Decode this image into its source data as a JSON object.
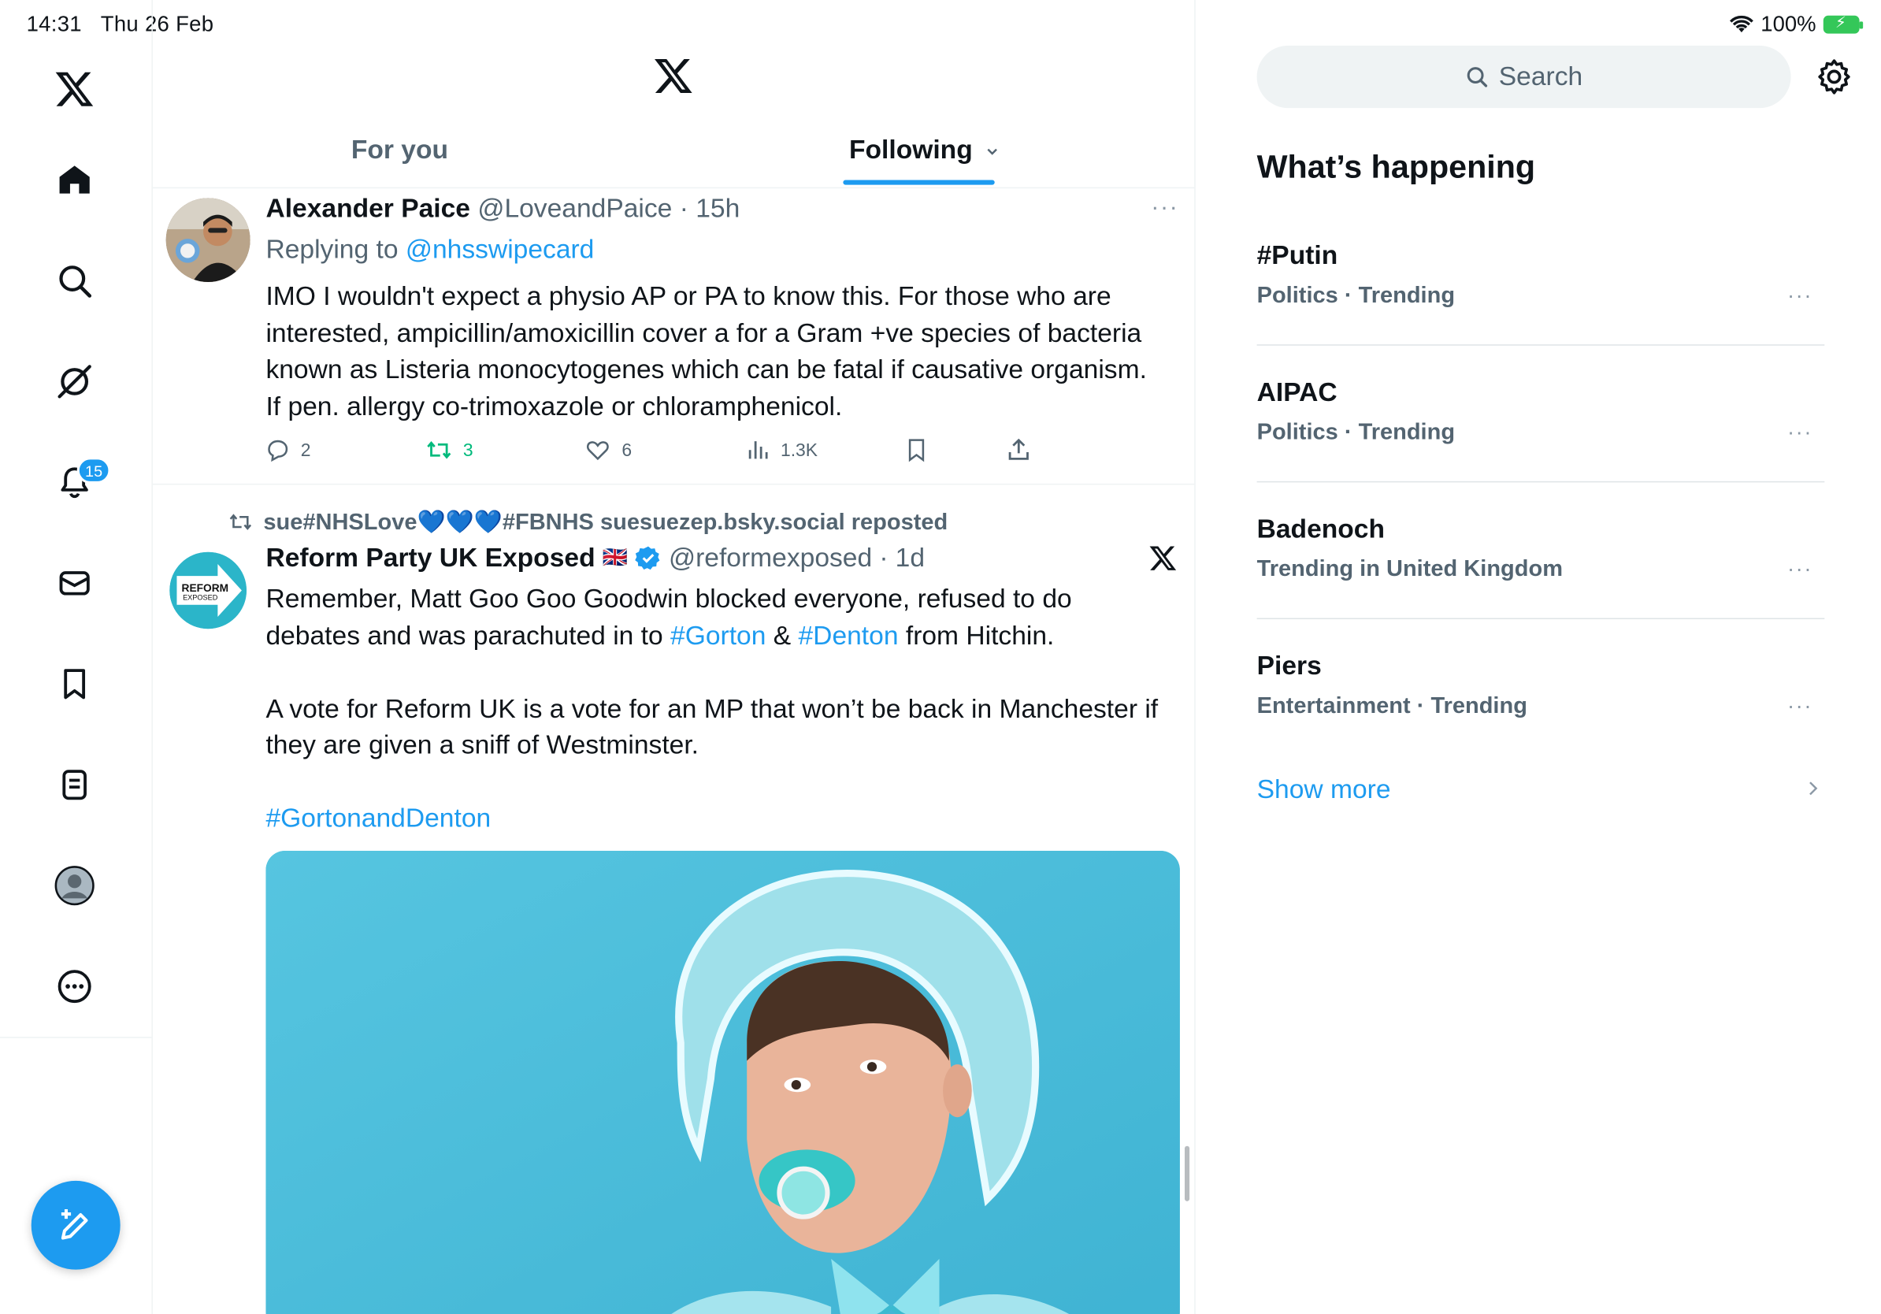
{
  "status_bar": {
    "time": "14:31",
    "date": "Thu 26 Feb",
    "battery": "100%"
  },
  "nav": {
    "items": [
      {
        "name": "home",
        "icon": "home-icon"
      },
      {
        "name": "explore",
        "icon": "search-icon"
      },
      {
        "name": "grok",
        "icon": "grok-icon"
      },
      {
        "name": "notifications",
        "icon": "bell-icon",
        "badge": "15"
      },
      {
        "name": "messages",
        "icon": "mail-icon"
      },
      {
        "name": "bookmarks",
        "icon": "bookmark-icon"
      },
      {
        "name": "lists",
        "icon": "list-icon"
      },
      {
        "name": "profile",
        "icon": "avatar-icon"
      },
      {
        "name": "more",
        "icon": "more-circle-icon"
      }
    ],
    "notifications_badge": "15"
  },
  "header": {
    "tabs": [
      "For you",
      "Following"
    ],
    "active_tab": "Following"
  },
  "tweets": [
    {
      "author_name": "Alexander Paice",
      "handle": "@LoveandPaice",
      "time": "15h",
      "replying_label": "Replying to",
      "replying_to": "@nhsswipecard",
      "text_lines": [
        "IMO I wouldn't expect a physio AP or PA to know this. For those who are",
        "interested, ampicillin/amoxicillin  cover a for a Gram +ve species of bacteria",
        "known as Listeria monocytogenes which can be fatal if causative organism.",
        "If pen. allergy co-trimoxazole or chloramphenicol."
      ],
      "replies": "2",
      "reposts": "3",
      "likes": "6",
      "views": "1.3K"
    },
    {
      "repost_label": "sue#NHSLove💙💙💙#FBNHS suesuezep.bsky.social reposted",
      "author_name": "Reform Party UK Exposed",
      "flag": "🇬🇧",
      "handle": "@reformexposed",
      "time": "1d",
      "avatar_text_1": "REFORM",
      "avatar_text_2": "EXPOSED",
      "line1": "Remember, Matt Goo Goo Goodwin blocked everyone, refused to do",
      "line2_pre": "debates and was parachuted in to ",
      "tag1": "#Gorton",
      "amp": " & ",
      "tag2": "#Denton",
      "line2_post": " from Hitchin.",
      "line3": "A vote for Reform UK is a vote for an MP that won’t be back in Manchester if",
      "line4": "they are given a sniff of Westminster.",
      "hashtag": "#GortonandDenton"
    }
  ],
  "sidebar": {
    "search_placeholder": "Search",
    "trends_title": "What’s happening",
    "trends": [
      {
        "name": "#Putin",
        "meta": "Politics · Trending"
      },
      {
        "name": "AIPAC",
        "meta": "Politics · Trending"
      },
      {
        "name": "Badenoch",
        "meta": "Trending in United Kingdom"
      },
      {
        "name": "Piers",
        "meta": "Entertainment · Trending"
      }
    ],
    "show_more": "Show more"
  },
  "colors": {
    "accent": "#1d9bf0",
    "repost_green": "#00ba7c",
    "muted": "#536471"
  }
}
